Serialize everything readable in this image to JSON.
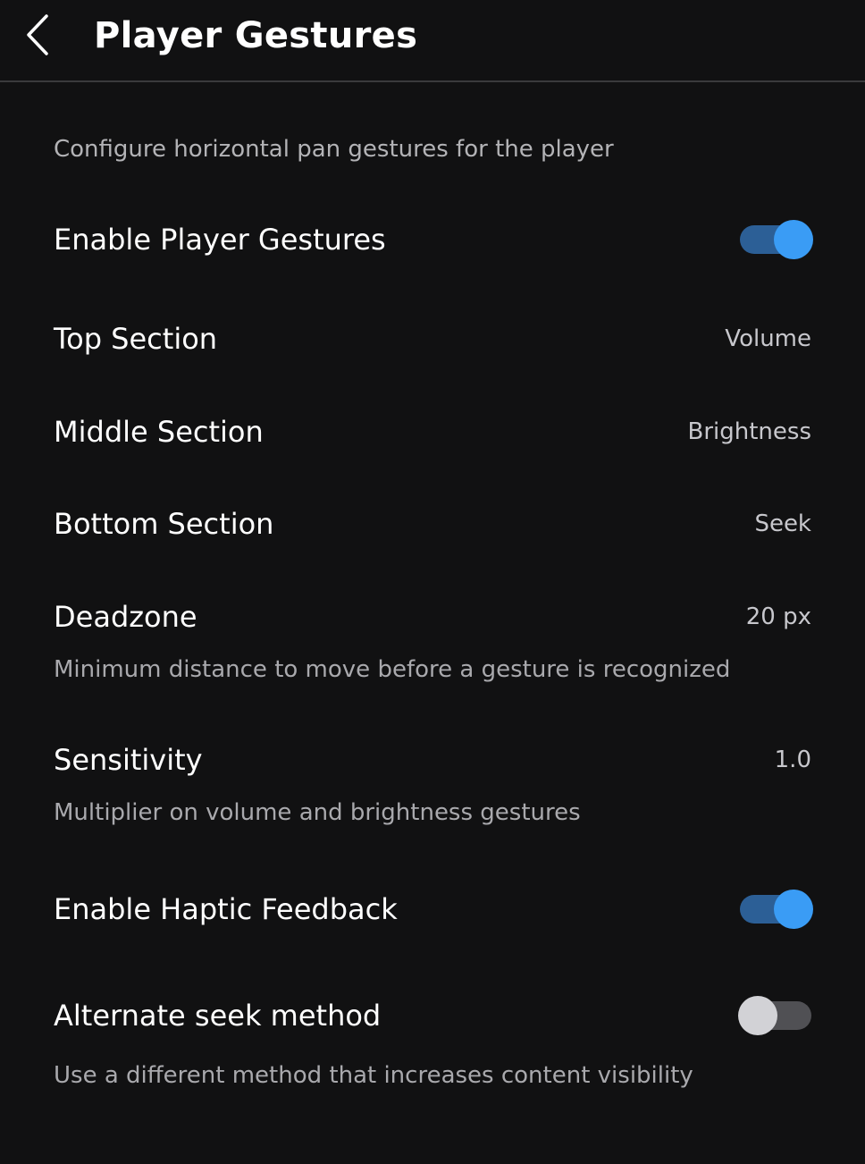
{
  "header": {
    "title": "Player Gestures",
    "back_icon": "chevron-left-icon"
  },
  "description": "Configure horizontal pan gestures for the player",
  "settings": {
    "enable_gestures": {
      "label": "Enable Player Gestures",
      "enabled": true
    },
    "top_section": {
      "label": "Top Section",
      "value": "Volume"
    },
    "middle_section": {
      "label": "Middle Section",
      "value": "Brightness"
    },
    "bottom_section": {
      "label": "Bottom Section",
      "value": "Seek"
    },
    "deadzone": {
      "label": "Deadzone",
      "value": "20 px",
      "subtitle": "Minimum distance to move before a gesture is recognized"
    },
    "sensitivity": {
      "label": "Sensitivity",
      "value": "1.0",
      "subtitle": "Multiplier on volume and brightness gestures"
    },
    "haptic_feedback": {
      "label": "Enable Haptic Feedback",
      "enabled": true
    },
    "alternate_seek": {
      "label": "Alternate seek method",
      "enabled": false,
      "subtitle": "Use a different method that increases content visibility"
    }
  },
  "colors": {
    "background": "#111112",
    "toggle_on_track": "#2c5f96",
    "toggle_on_knob": "#3a9cf5",
    "toggle_off_track": "#505054",
    "toggle_off_knob": "#d2d2d6"
  }
}
